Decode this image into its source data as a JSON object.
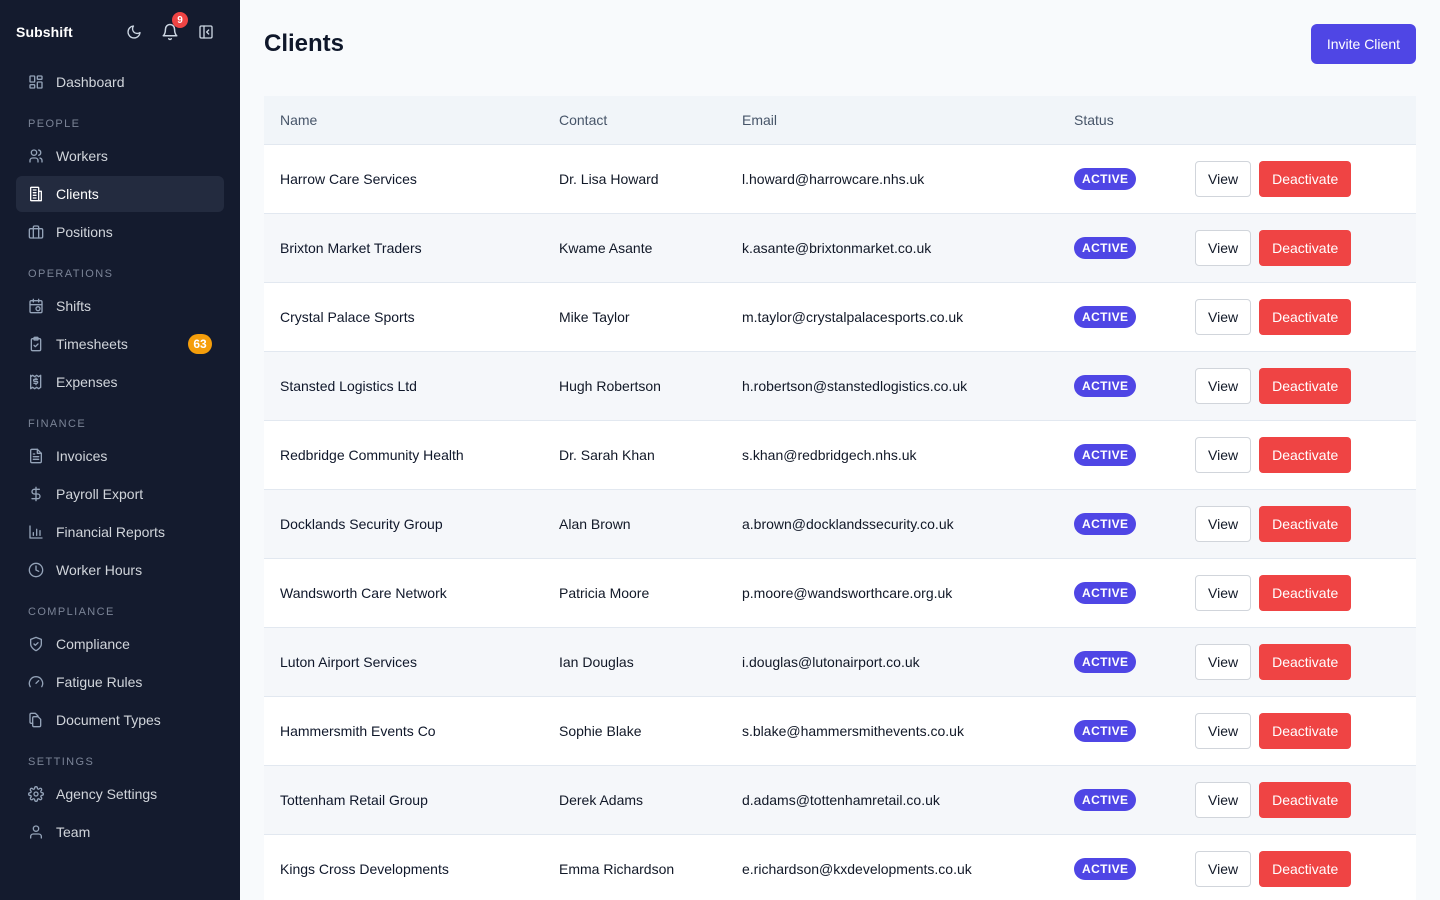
{
  "app": {
    "brand": "Subshift",
    "notification_count": "9"
  },
  "sidebar": {
    "top": [
      {
        "label": "Dashboard",
        "icon": "grid-icon"
      }
    ],
    "sections": [
      {
        "title": "PEOPLE",
        "items": [
          {
            "label": "Workers",
            "icon": "users-icon"
          },
          {
            "label": "Clients",
            "icon": "building-icon",
            "active": true
          },
          {
            "label": "Positions",
            "icon": "briefcase-icon"
          }
        ]
      },
      {
        "title": "OPERATIONS",
        "items": [
          {
            "label": "Shifts",
            "icon": "calendar-clock-icon"
          },
          {
            "label": "Timesheets",
            "icon": "clipboard-check-icon",
            "badge": "63"
          },
          {
            "label": "Expenses",
            "icon": "receipt-icon"
          }
        ]
      },
      {
        "title": "FINANCE",
        "items": [
          {
            "label": "Invoices",
            "icon": "file-text-icon"
          },
          {
            "label": "Payroll Export",
            "icon": "dollar-icon"
          },
          {
            "label": "Financial Reports",
            "icon": "bar-chart-icon"
          },
          {
            "label": "Worker Hours",
            "icon": "clock-icon"
          }
        ]
      },
      {
        "title": "COMPLIANCE",
        "items": [
          {
            "label": "Compliance",
            "icon": "shield-check-icon"
          },
          {
            "label": "Fatigue Rules",
            "icon": "gauge-icon"
          },
          {
            "label": "Document Types",
            "icon": "files-icon"
          }
        ]
      },
      {
        "title": "SETTINGS",
        "items": [
          {
            "label": "Agency Settings",
            "icon": "gear-icon"
          },
          {
            "label": "Team",
            "icon": "user-icon"
          }
        ]
      }
    ]
  },
  "page": {
    "title": "Clients",
    "invite_label": "Invite Client"
  },
  "table": {
    "headers": {
      "name": "Name",
      "contact": "Contact",
      "email": "Email",
      "status": "Status"
    },
    "view_label": "View",
    "deactivate_label": "Deactivate",
    "rows": [
      {
        "name": "Harrow Care Services",
        "contact": "Dr. Lisa Howard",
        "email": "l.howard@harrowcare.nhs.uk",
        "status": "ACTIVE"
      },
      {
        "name": "Brixton Market Traders",
        "contact": "Kwame Asante",
        "email": "k.asante@brixtonmarket.co.uk",
        "status": "ACTIVE"
      },
      {
        "name": "Crystal Palace Sports",
        "contact": "Mike Taylor",
        "email": "m.taylor@crystalpalacesports.co.uk",
        "status": "ACTIVE"
      },
      {
        "name": "Stansted Logistics Ltd",
        "contact": "Hugh Robertson",
        "email": "h.robertson@stanstedlogistics.co.uk",
        "status": "ACTIVE"
      },
      {
        "name": "Redbridge Community Health",
        "contact": "Dr. Sarah Khan",
        "email": "s.khan@redbridgech.nhs.uk",
        "status": "ACTIVE"
      },
      {
        "name": "Docklands Security Group",
        "contact": "Alan Brown",
        "email": "a.brown@docklandssecurity.co.uk",
        "status": "ACTIVE"
      },
      {
        "name": "Wandsworth Care Network",
        "contact": "Patricia Moore",
        "email": "p.moore@wandsworthcare.org.uk",
        "status": "ACTIVE"
      },
      {
        "name": "Luton Airport Services",
        "contact": "Ian Douglas",
        "email": "i.douglas@lutonairport.co.uk",
        "status": "ACTIVE"
      },
      {
        "name": "Hammersmith Events Co",
        "contact": "Sophie Blake",
        "email": "s.blake@hammersmithevents.co.uk",
        "status": "ACTIVE"
      },
      {
        "name": "Tottenham Retail Group",
        "contact": "Derek Adams",
        "email": "d.adams@tottenhamretail.co.uk",
        "status": "ACTIVE"
      },
      {
        "name": "Kings Cross Developments",
        "contact": "Emma Richardson",
        "email": "e.richardson@kxdevelopments.co.uk",
        "status": "ACTIVE"
      }
    ]
  },
  "colors": {
    "sidebar_bg": "#141b2e",
    "accent": "#4f46e5",
    "danger": "#ef4444",
    "warning": "#f59e0b"
  }
}
